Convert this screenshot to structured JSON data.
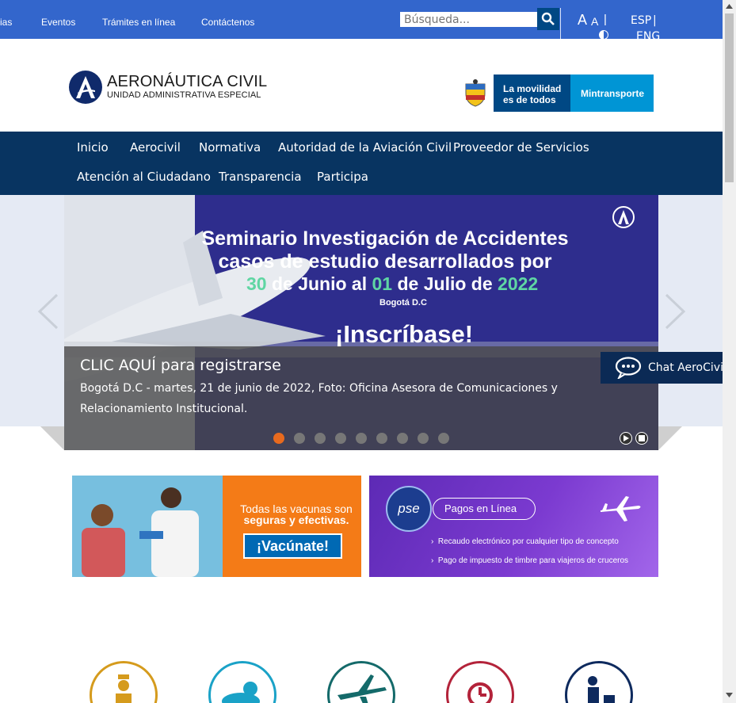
{
  "topbar": {
    "links": [
      "ias",
      "Eventos",
      "Trámites en línea",
      "Contáctenos"
    ],
    "search_placeholder": "Búsqueda...",
    "font_big": "A",
    "font_small": "A",
    "sep": "|",
    "lang_esp": "ESP",
    "lang_sep": "|",
    "lang_eng": "ENG"
  },
  "header": {
    "logo_title": "AERONÁUTICA CIVIL",
    "logo_subtitle": "UNIDAD ADMINISTRATIVA ESPECIAL",
    "gov_slogan_1": "La movilidad",
    "gov_slogan_2": "es de todos",
    "gov_ministry": "Mintransporte"
  },
  "nav": {
    "row1": [
      "Inicio",
      "Aerocivil",
      "Normativa",
      "Autoridad de la Aviación Civil",
      "Proveedor de Servicios"
    ],
    "row2": [
      "Atención al Ciudadano",
      "Transparencia",
      "Participa"
    ]
  },
  "slider": {
    "line1": "Seminario Investigación de Accidentes",
    "line2": "casos de estudio desarrollados por",
    "date_a": "30",
    "date_b": " de Junio al ",
    "date_c": "01",
    "date_d": " de Julio de ",
    "date_e": "2022",
    "city": "Bogotá D.C",
    "cta": "¡Inscríbase!",
    "caption_title": "CLIC AQUÍ para registrarse",
    "caption_desc": "Bogotá D.C - martes, 21 de junio de 2022, Foto: Oficina Asesora de Comunicaciones y Relacionamiento Institucional.",
    "slide_count": 9,
    "active_index": 0
  },
  "chat": {
    "label": "Chat AeroCivil"
  },
  "banners": {
    "vaccine_text_1": "Todas las vacunas son",
    "vaccine_text_2": "seguras y efectivas.",
    "vaccine_cta": "¡Vacúnate!",
    "pse_logo": "pse",
    "pse_title": "Pagos en Línea",
    "pse_item_1": "Recaudo electrónico por cualquier tipo de concepto",
    "pse_item_2": "Pago de impuesto de timbre para viajeros de cruceros"
  },
  "colors": {
    "topbar": "#3366cc",
    "nav": "#083461",
    "accent": "#e86a1e"
  }
}
